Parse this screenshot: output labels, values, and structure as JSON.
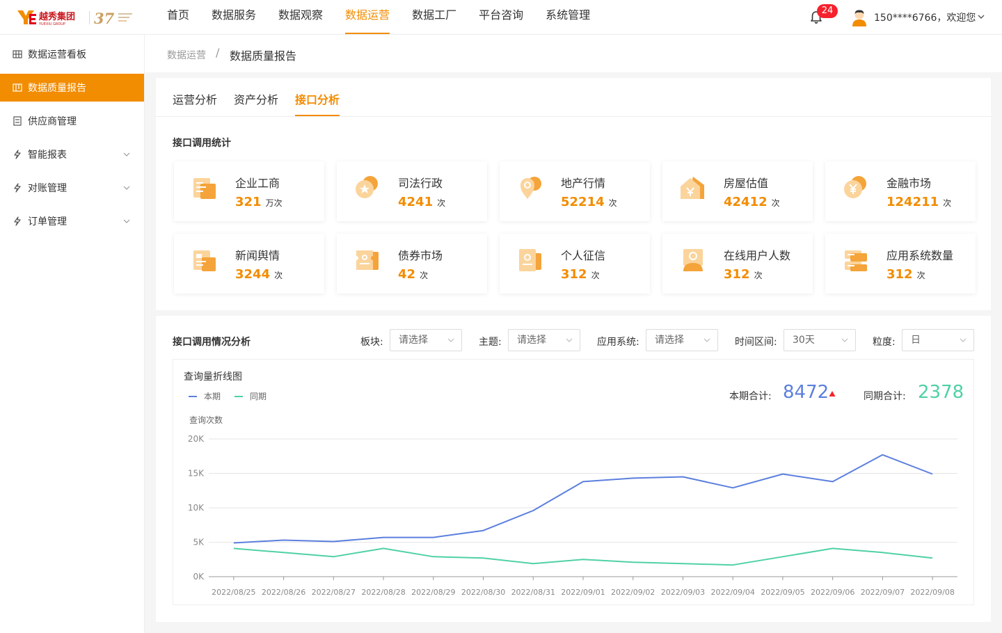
{
  "brand": {
    "logo_text": "越秀集团",
    "logo_sub": "YUEXIU GROUP",
    "anniv": "37"
  },
  "nav": {
    "items": [
      {
        "label": "首页",
        "active": false
      },
      {
        "label": "数据服务",
        "active": false
      },
      {
        "label": "数据观察",
        "active": false
      },
      {
        "label": "数据运营",
        "active": true
      },
      {
        "label": "数据工厂",
        "active": false
      },
      {
        "label": "平台咨询",
        "active": false
      },
      {
        "label": "系统管理",
        "active": false
      }
    ],
    "notification_count": "24",
    "user_label": "150****6766，欢迎您"
  },
  "sidebar": {
    "items": [
      {
        "label": "数据运营看板",
        "icon": "grid-icon",
        "active": false,
        "expandable": false
      },
      {
        "label": "数据质量报告",
        "icon": "report-icon",
        "active": true,
        "expandable": false
      },
      {
        "label": "供应商管理",
        "icon": "supplier-icon",
        "active": false,
        "expandable": false
      },
      {
        "label": "智能报表",
        "icon": "lightning-icon",
        "active": false,
        "expandable": true
      },
      {
        "label": "对账管理",
        "icon": "lightning-icon",
        "active": false,
        "expandable": true
      },
      {
        "label": "订单管理",
        "icon": "lightning-icon",
        "active": false,
        "expandable": true
      }
    ]
  },
  "breadcrumb": {
    "parent": "数据运营",
    "separator": "/",
    "current": "数据质量报告"
  },
  "tabs": [
    {
      "label": "运营分析",
      "active": false
    },
    {
      "label": "资产分析",
      "active": false
    },
    {
      "label": "接口分析",
      "active": true
    }
  ],
  "stats": {
    "title": "接口调用统计",
    "cards": [
      {
        "name": "企业工商",
        "value": "321",
        "unit": "万次",
        "icon": "doc-icon"
      },
      {
        "name": "司法行政",
        "value": "4241",
        "unit": "次",
        "icon": "star-coin-icon"
      },
      {
        "name": "地产行情",
        "value": "52214",
        "unit": "次",
        "icon": "location-icon"
      },
      {
        "name": "房屋估值",
        "value": "42412",
        "unit": "次",
        "icon": "house-yuan-icon"
      },
      {
        "name": "金融市场",
        "value": "124211",
        "unit": "次",
        "icon": "yuan-coin-icon"
      },
      {
        "name": "新闻舆情",
        "value": "3244",
        "unit": "次",
        "icon": "news-icon"
      },
      {
        "name": "债券市场",
        "value": "42",
        "unit": "次",
        "icon": "ticket-icon"
      },
      {
        "name": "个人征信",
        "value": "312",
        "unit": "次",
        "icon": "id-card-icon"
      },
      {
        "name": "在线用户人数",
        "value": "312",
        "unit": "次",
        "icon": "user-icon"
      },
      {
        "name": "应用系统数量",
        "value": "312",
        "unit": "次",
        "icon": "app-icon"
      }
    ]
  },
  "analysis": {
    "title": "接口调用情况分析",
    "filters": [
      {
        "label": "板块:",
        "value": "请选择"
      },
      {
        "label": "主题:",
        "value": "请选择"
      },
      {
        "label": "应用系统:",
        "value": "请选择"
      },
      {
        "label": "时间区间:",
        "value": "30天"
      },
      {
        "label": "粒度:",
        "value": "日"
      }
    ]
  },
  "summary": {
    "current_label": "本期合计:",
    "current_value": "8472",
    "previous_label": "同期合计:",
    "previous_value": "2378"
  },
  "chart_data": {
    "type": "line",
    "title": "查询量折线图",
    "ylabel": "查询次数",
    "x": [
      "2022/08/25",
      "2022/08/26",
      "2022/08/27",
      "2022/08/28",
      "2022/08/29",
      "2022/08/30",
      "2022/08/31",
      "2022/09/01",
      "2022/09/02",
      "2022/09/03",
      "2022/09/04",
      "2022/09/05",
      "2022/09/06",
      "2022/09/07",
      "2022/09/08"
    ],
    "ylim": [
      0,
      20000
    ],
    "yticks": [
      0,
      5000,
      10000,
      15000,
      20000
    ],
    "yticklabels": [
      "0K",
      "5K",
      "10K",
      "15K",
      "20K"
    ],
    "grid": true,
    "legend": "top-left",
    "series": [
      {
        "name": "本期",
        "color": "#5b7fde",
        "values": [
          4900,
          5300,
          5100,
          5700,
          5700,
          6700,
          9600,
          13800,
          14300,
          14500,
          12900,
          14900,
          13800,
          17700,
          14900
        ]
      },
      {
        "name": "同期",
        "color": "#4fd1a5",
        "values": [
          4100,
          3500,
          2900,
          4100,
          2900,
          2700,
          1900,
          2500,
          2100,
          1900,
          1700,
          2900,
          4100,
          3500,
          2700
        ]
      }
    ]
  },
  "colors": {
    "accent": "#f28c00",
    "current": "#5b7fde",
    "previous": "#4fd1a5",
    "up": "#f5222d"
  }
}
